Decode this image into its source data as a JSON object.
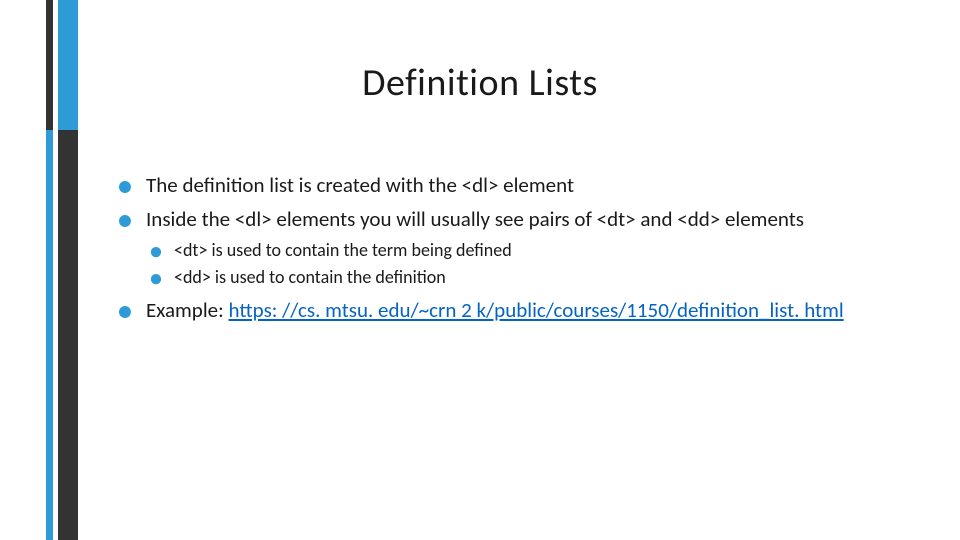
{
  "title": "Definition Lists",
  "bullets": [
    {
      "text": "The definition list is created with the <dl> element"
    },
    {
      "text": "Inside the <dl> elements you will usually see pairs of <dt> and <dd> elements",
      "sub": [
        "<dt> is used to contain the term being defined",
        "<dd> is used to contain the definition"
      ]
    },
    {
      "text_prefix": "Example: ",
      "link_text": "https: //cs. mtsu. edu/~crn 2 k/public/courses/1150/definition_list. html",
      "link_href": "https://cs.mtsu.edu/~crn2k/public/courses/1150/definition_list.html"
    }
  ]
}
